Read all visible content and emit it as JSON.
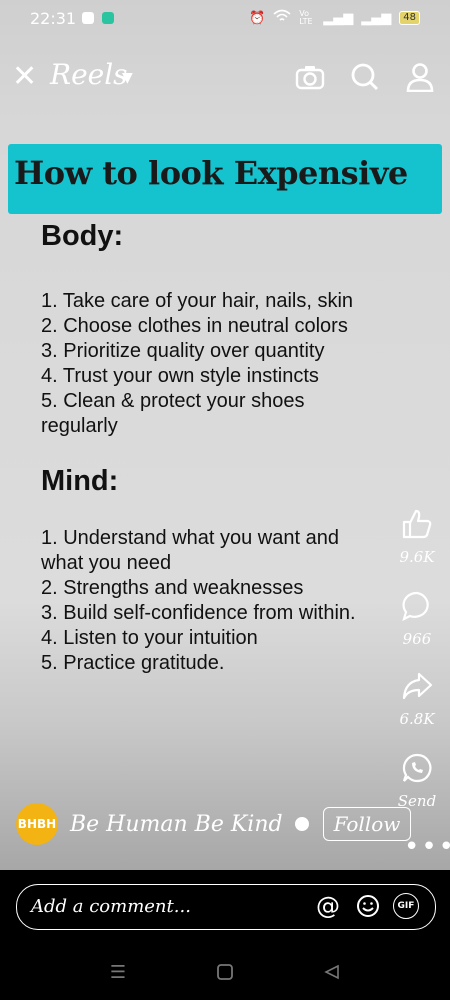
{
  "status_bar": {
    "time": "22:31",
    "network": "Vo LTE",
    "battery": "48"
  },
  "header": {
    "close_label": "✕",
    "title": "Reels",
    "icons": [
      "camera-icon",
      "search-icon",
      "profile-icon"
    ]
  },
  "post": {
    "headline": "How to look Expensive",
    "body_heading": "Body:",
    "body_items": [
      "1. Take care of your hair, nails, skin",
      "2. Choose clothes in neutral colors",
      "3. Prioritize quality over quantity",
      "4. Trust your own style instincts",
      "5. Clean & protect your shoes",
      "regularly"
    ],
    "mind_heading": "Mind:",
    "mind_items": [
      "1. Understand what you want and",
      "what you need",
      "2. Strengths and weaknesses",
      "3. Build self-confidence from within.",
      "4. Listen to your intuition",
      "5. Practice gratitude."
    ]
  },
  "actions": {
    "likes": "9.6K",
    "comments": "966",
    "shares": "6.8K",
    "send": "Send"
  },
  "author": {
    "avatar_text": "BHBH",
    "name": "Be Human Be Kind",
    "follow_label": "Follow"
  },
  "comment": {
    "placeholder": "Add a comment...",
    "gif_label": "GIF"
  },
  "colors": {
    "headline_bg": "#15c3cf",
    "avatar_bg": "#f2b313"
  }
}
